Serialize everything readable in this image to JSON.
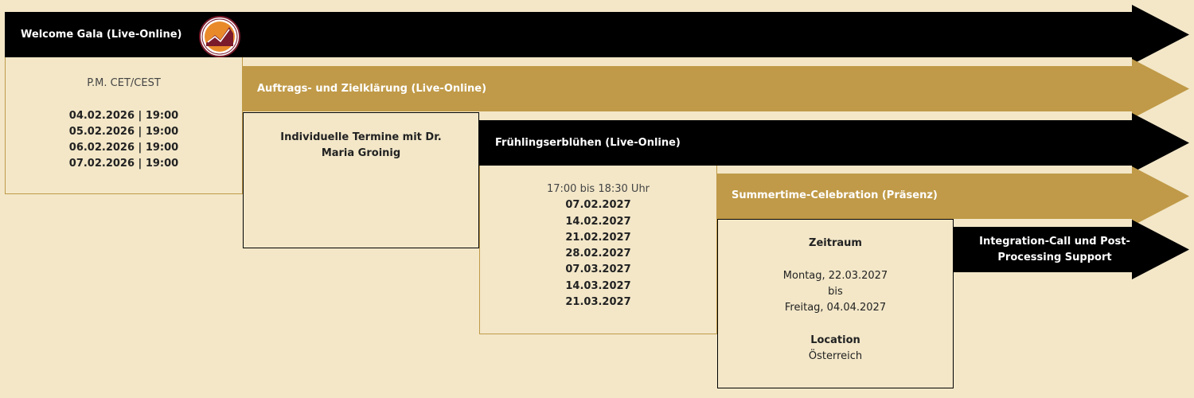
{
  "colors": {
    "black": "#000000",
    "gold": "#c09a48",
    "background": "#f3e7c8",
    "text_on_bar": "#ffffff"
  },
  "logo": {
    "icon": "logo-icon",
    "text": "TRUST THE PROCESS • DR. MARIA GROINIG"
  },
  "stages": [
    {
      "label": "Welcome Gala (Live-Online)",
      "color": "black"
    },
    {
      "label": "Auftrags- und Zielklärung (Live-Online)",
      "color": "gold"
    },
    {
      "label": "Frühlingserblühen (Live-Online)",
      "color": "black"
    },
    {
      "label": "Summertime-Celebration (Präsenz)",
      "color": "gold"
    },
    {
      "label": "Integration-Call und Post-Processing Support",
      "color": "black"
    }
  ],
  "boxes": [
    {
      "lines": [
        "P.M. CET/CEST",
        "",
        "04.02.2026 | 19:00",
        "05.02.2026 | 19:00",
        "06.02.2026 | 19:00",
        "07.02.2026 | 19:00"
      ]
    },
    {
      "lines": [
        "Individuelle Termine mit Dr. Maria Groinig"
      ]
    },
    {
      "lines": [
        "17:00 bis 18:30 Uhr",
        "07.02.2027",
        "14.02.2027",
        "21.02.2027",
        "28.02.2027",
        "07.03.2027",
        "14.03.2027",
        "21.03.2027"
      ]
    },
    {
      "lines": [
        "Zeitraum",
        "",
        "Montag, 22.03.2027",
        "bis",
        "Freitag, 04.04.2027",
        "",
        "Location",
        "Österreich"
      ]
    }
  ]
}
